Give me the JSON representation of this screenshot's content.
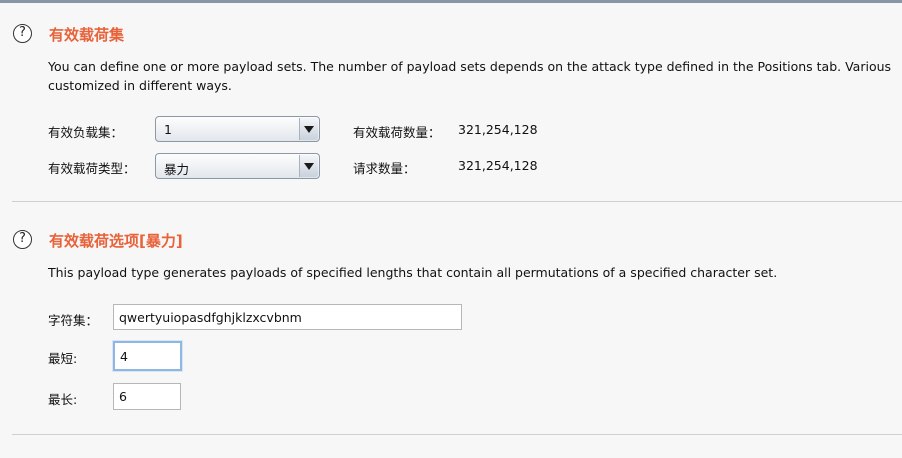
{
  "payload_sets": {
    "title": "有效载荷集",
    "description_line1": "You can define one or more payload sets. The number of payload sets depends on the attack type defined in the Positions tab. Various",
    "description_line2": "customized in different ways.",
    "payload_set_label": "有效负载集：",
    "payload_set_value": "1",
    "payload_type_label": "有效载荷类型：",
    "payload_type_value": "暴力",
    "payload_count_label": "有效载荷数量：",
    "payload_count_value": "321,254,128",
    "request_count_label": "请求数量：",
    "request_count_value": "321,254,128"
  },
  "payload_options": {
    "title": "有效载荷选项[暴力]",
    "description": "This payload type generates payloads of specified lengths that contain all permutations of a specified character set.",
    "charset_label": "字符集：",
    "charset_value": "qwertyuiopasdfghjklzxcvbnm",
    "min_label": "最短:",
    "min_value": "4",
    "max_label": "最长:",
    "max_value": "6"
  },
  "icons": {
    "help": "?"
  },
  "colors": {
    "section_title": "#e8623a",
    "focus_border": "#8fb7e0"
  }
}
